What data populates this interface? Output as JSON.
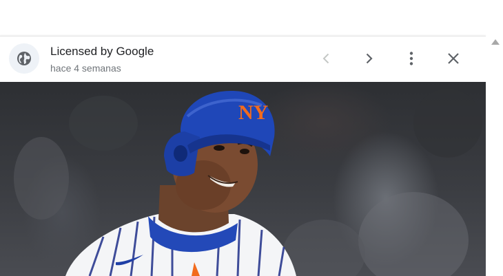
{
  "viewer": {
    "source_label": "Licensed by Google",
    "time_label": "hace 4 semanas",
    "icons": {
      "globe": "globe-icon",
      "prev": "chevron-left-icon",
      "next": "chevron-right-icon",
      "more": "more-vert-icon",
      "close": "close-icon"
    },
    "image": {
      "logo_text": "NY"
    }
  },
  "colors": {
    "helmet": "#1f47b8",
    "logo": "#f26b1d",
    "icon_active": "#5f6368",
    "icon_disabled": "#c4c7c5"
  }
}
